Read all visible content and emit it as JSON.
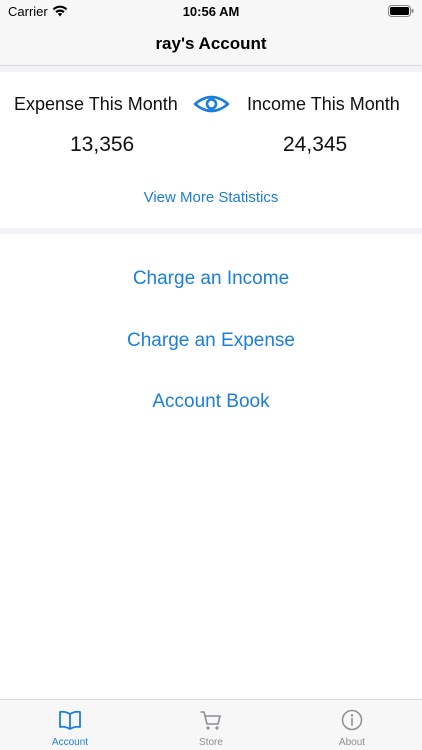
{
  "status_bar": {
    "carrier": "Carrier",
    "time": "10:56 AM",
    "icons": [
      "wifi-icon",
      "battery-icon"
    ]
  },
  "nav": {
    "title": "ray's Account"
  },
  "summary": {
    "expense_label": "Expense This Month",
    "expense_value": "13,356",
    "income_label": "Income This Month",
    "income_value": "24,345",
    "toggle_icon": "eye-icon",
    "view_more": "View More Statistics"
  },
  "actions": {
    "charge_income": "Charge an Income",
    "charge_expense": "Charge an Expense",
    "account_book": "Account Book"
  },
  "tabs": [
    {
      "label": "Account",
      "icon": "book-icon",
      "active": true
    },
    {
      "label": "Store",
      "icon": "cart-icon",
      "active": false
    },
    {
      "label": "About",
      "icon": "info-icon",
      "active": false
    }
  ],
  "colors": {
    "accent": "#1a7ee0",
    "inactive": "#8e8e93",
    "bar_background": "#f7f7f7",
    "separator_band": "#f2f2f7"
  }
}
